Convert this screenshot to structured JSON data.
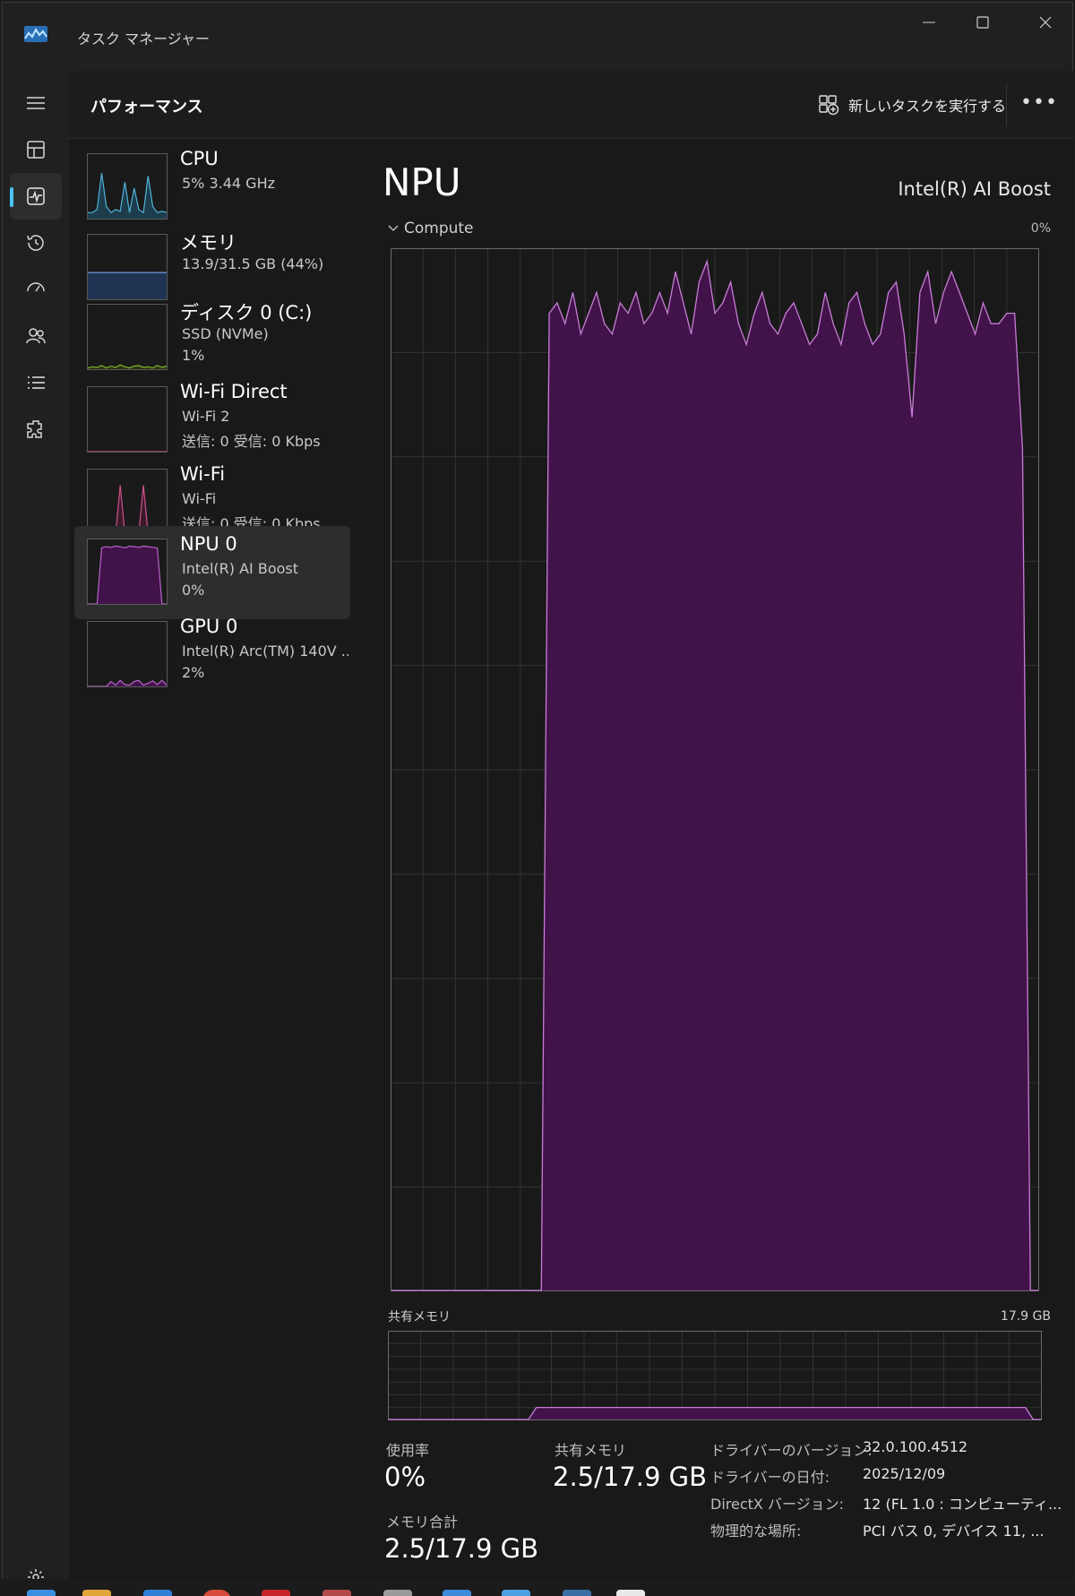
{
  "window": {
    "title": "タスク マネージャー",
    "controls": [
      "minimize",
      "maximize",
      "close"
    ]
  },
  "header": {
    "page_title": "パフォーマンス",
    "run_task_label": "新しいタスクを実行する",
    "more_label": "•••"
  },
  "nav": [
    {
      "icon": "menu-icon"
    },
    {
      "icon": "processes-icon"
    },
    {
      "icon": "performance-icon",
      "active": true
    },
    {
      "icon": "app-history-icon"
    },
    {
      "icon": "startup-icon"
    },
    {
      "icon": "users-icon"
    },
    {
      "icon": "details-icon"
    },
    {
      "icon": "services-icon"
    }
  ],
  "devices": [
    {
      "name": "CPU",
      "line1": "5%  3.44 GHz",
      "line2": "",
      "color": "#4fb3d9",
      "fill": "#1d3d4d"
    },
    {
      "name": "メモリ",
      "line1": "13.9/31.5 GB (44%)",
      "line2": "",
      "color": "#6d9ad8",
      "fill": "#1f3352"
    },
    {
      "name": "ディスク 0 (C:)",
      "line1": "SSD (NVMe)",
      "line2": "1%",
      "color": "#7fb82f",
      "fill": "#26330f"
    },
    {
      "name": "Wi-Fi Direct",
      "line1": "Wi-Fi 2",
      "line2": "送信: 0  受信: 0 Kbps",
      "color": "#d1528a",
      "fill": "#3a1a28"
    },
    {
      "name": "Wi-Fi",
      "line1": "Wi-Fi",
      "line2": "送信: 0  受信: 0 Kbps",
      "color": "#d1528a",
      "fill": "#3a1a28"
    },
    {
      "name": "NPU 0",
      "line1": "Intel(R) AI Boost",
      "line2": "0%",
      "color": "#b565c8",
      "fill": "#42124a",
      "active": true
    },
    {
      "name": "GPU 0",
      "line1": "Intel(R) Arc(TM) 140V ...",
      "line2": "2%",
      "color": "#b565c8",
      "fill": "#42124a"
    }
  ],
  "detail": {
    "title": "NPU",
    "model": "Intel(R) AI Boost",
    "compute_label": "Compute",
    "compute_max": "0%",
    "shared_mem_label": "共有メモリ",
    "shared_mem_max": "17.9 GB",
    "usage_label": "使用率",
    "usage_value": "0%",
    "shared_label": "共有メモリ",
    "shared_value": "2.5/17.9 GB",
    "mem_total_label": "メモリ合計",
    "mem_total_value": "2.5/17.9 GB",
    "properties": [
      {
        "key": "ドライバーのバージョン:",
        "value": "32.0.100.4512"
      },
      {
        "key": "ドライバーの日付:",
        "value": "2025/12/09"
      },
      {
        "key": "DirectX バージョン:",
        "value": "12 (FL 1.0 : コンピューティ..."
      },
      {
        "key": "物理的な場所:",
        "value": "PCI バス 0, デバイス 11, ..."
      }
    ]
  },
  "colors": {
    "accent": "#4cc2ff",
    "npu_line": "#c77dd6",
    "npu_fill": "#42124a"
  },
  "compute_utilization": [
    0,
    0,
    0,
    0,
    0,
    0,
    0,
    0,
    0,
    0,
    0,
    0,
    0,
    0,
    0,
    0,
    0,
    0,
    0,
    0,
    94,
    95,
    93,
    96,
    92,
    94,
    96,
    93,
    92,
    95,
    94,
    96,
    93,
    94,
    96,
    94,
    98,
    95,
    92,
    97,
    99,
    94,
    95,
    97,
    93,
    91,
    94,
    96,
    93,
    92,
    94,
    95,
    93,
    91,
    92,
    96,
    93,
    91,
    95,
    96,
    93,
    91,
    92,
    96,
    97,
    92,
    84,
    96,
    98,
    93,
    96,
    98,
    96,
    94,
    92,
    95,
    93,
    93,
    94,
    94,
    81,
    0,
    0
  ],
  "shared_memory_gb": [
    0.0,
    0.0,
    0.0,
    0.0,
    0.0,
    0.0,
    0.0,
    0.0,
    0.0,
    0.0,
    0.0,
    0.0,
    0.0,
    0.0,
    0.0,
    0.0,
    0.0,
    0.0,
    0.0,
    2.5,
    2.5,
    2.5,
    2.5,
    2.5,
    2.5,
    2.5,
    2.5,
    2.5,
    2.5,
    2.5,
    2.5,
    2.5,
    2.5,
    2.5,
    2.5,
    2.5,
    2.5,
    2.5,
    2.5,
    2.5,
    2.5,
    2.5,
    2.5,
    2.5,
    2.5,
    2.5,
    2.5,
    2.5,
    2.5,
    2.5,
    2.5,
    2.5,
    2.5,
    2.5,
    2.5,
    2.5,
    2.5,
    2.5,
    2.5,
    2.5,
    2.5,
    2.5,
    2.5,
    2.5,
    2.5,
    2.5,
    2.5,
    2.5,
    2.5,
    2.5,
    2.5,
    2.5,
    2.5,
    2.5,
    2.5,
    2.5,
    2.5,
    2.5,
    2.5,
    2.5,
    2.5,
    2.5,
    2.5,
    0.0,
    0.0
  ]
}
